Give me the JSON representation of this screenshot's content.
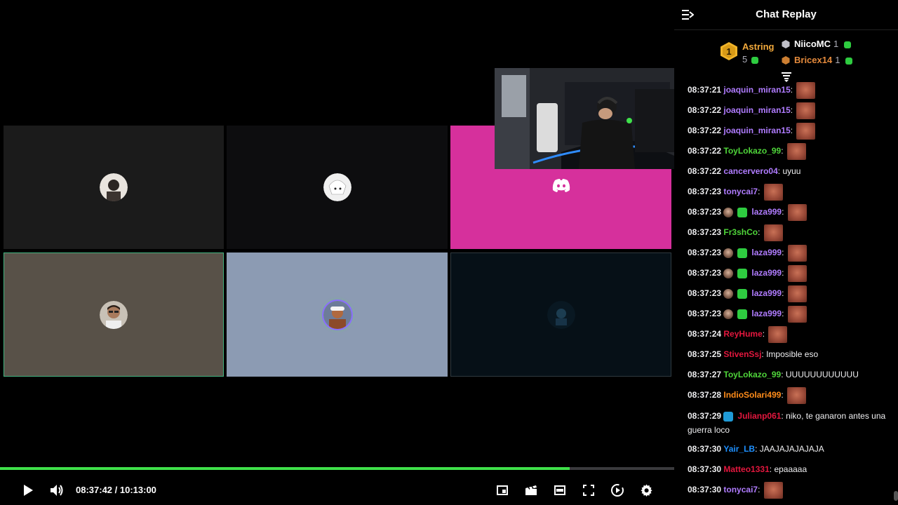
{
  "player": {
    "current_time": "08:37:42",
    "duration": "10:13:00",
    "time_display": "08:37:42 / 10:13:00",
    "progress_fraction": 0.845,
    "accent_color": "#3fe14a"
  },
  "chat": {
    "title": "Chat Replay",
    "leaderboard": {
      "first": {
        "rank": "1",
        "name": "Astring",
        "count": "5"
      },
      "second": {
        "name": "NiicoMC",
        "count": "1"
      },
      "third": {
        "name": "Bricex14",
        "count": "1"
      }
    },
    "messages": [
      {
        "time": "08:37:21",
        "user": "joaquin_miran15",
        "color": "#b07cff",
        "badges": [],
        "text": "",
        "emote": true
      },
      {
        "time": "08:37:22",
        "user": "joaquin_miran15",
        "color": "#b07cff",
        "badges": [],
        "text": "",
        "emote": true
      },
      {
        "time": "08:37:22",
        "user": "joaquin_miran15",
        "color": "#b07cff",
        "badges": [],
        "text": "",
        "emote": true
      },
      {
        "time": "08:37:22",
        "user": "ToyLokazo_99",
        "color": "#4fd53a",
        "badges": [],
        "text": "",
        "emote": true
      },
      {
        "time": "08:37:22",
        "user": "cancervero04",
        "color": "#b07cff",
        "badges": [],
        "text": "uyuu",
        "emote": false
      },
      {
        "time": "08:37:23",
        "user": "tonycai7",
        "color": "#b07cff",
        "badges": [],
        "text": "",
        "emote": true
      },
      {
        "time": "08:37:23",
        "user": "laza999",
        "color": "#b07cff",
        "badges": [
          "face",
          "green"
        ],
        "text": "",
        "emote": true
      },
      {
        "time": "08:37:23",
        "user": "Fr3shCo",
        "color": "#4fd53a",
        "badges": [],
        "text": "",
        "emote": true
      },
      {
        "time": "08:37:23",
        "user": "laza999",
        "color": "#b07cff",
        "badges": [
          "face",
          "green"
        ],
        "text": "",
        "emote": true
      },
      {
        "time": "08:37:23",
        "user": "laza999",
        "color": "#b07cff",
        "badges": [
          "face",
          "green"
        ],
        "text": "",
        "emote": true
      },
      {
        "time": "08:37:23",
        "user": "laza999",
        "color": "#b07cff",
        "badges": [
          "face",
          "green"
        ],
        "text": "",
        "emote": true
      },
      {
        "time": "08:37:23",
        "user": "laza999",
        "color": "#b07cff",
        "badges": [
          "face",
          "green"
        ],
        "text": "",
        "emote": true
      },
      {
        "time": "08:37:24",
        "user": "ReyHume",
        "color": "#e3173e",
        "badges": [],
        "text": "",
        "emote": true
      },
      {
        "time": "08:37:25",
        "user": "StivenSsj",
        "color": "#e3173e",
        "badges": [],
        "text": "Imposible eso",
        "emote": false
      },
      {
        "time": "08:37:27",
        "user": "ToyLokazo_99",
        "color": "#4fd53a",
        "badges": [],
        "text": "UUUUUUUUUUUU",
        "emote": false
      },
      {
        "time": "08:37:28",
        "user": "IndioSolari499",
        "color": "#ff8c1a",
        "badges": [],
        "text": "",
        "emote": true
      },
      {
        "time": "08:37:29",
        "user": "Julianp061",
        "color": "#e3173e",
        "badges": [
          "blue"
        ],
        "text": "niko, te ganaron antes una guerra loco",
        "emote": false,
        "wrap": true
      },
      {
        "time": "08:37:30",
        "user": "Yair_LB",
        "color": "#1e90ff",
        "badges": [],
        "text": "JAAJAJAJAJAJA",
        "emote": false
      },
      {
        "time": "08:37:30",
        "user": "Matteo1331",
        "color": "#e3173e",
        "badges": [],
        "text": "epaaaaa",
        "emote": false
      },
      {
        "time": "08:37:30",
        "user": "tonycai7",
        "color": "#b07cff",
        "badges": [],
        "text": "",
        "emote": true
      }
    ]
  }
}
